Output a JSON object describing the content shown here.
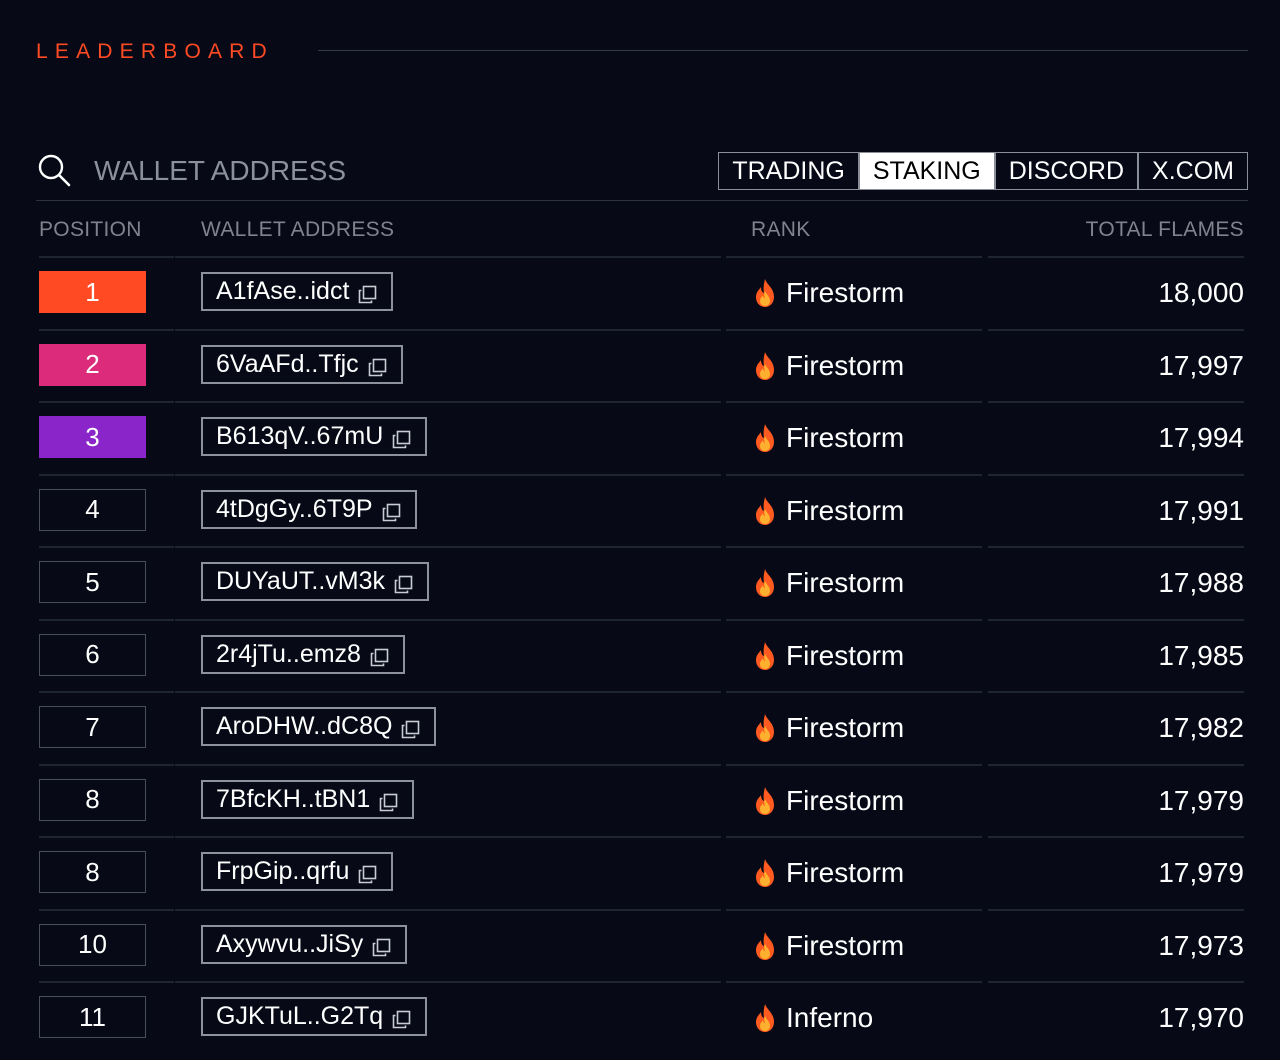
{
  "header": {
    "title": "LEADERBOARD"
  },
  "search": {
    "placeholder": "WALLET ADDRESS",
    "value": ""
  },
  "tabs": [
    {
      "label": "TRADING",
      "active": false
    },
    {
      "label": "STAKING",
      "active": true
    },
    {
      "label": "DISCORD",
      "active": false
    },
    {
      "label": "X.COM",
      "active": false
    }
  ],
  "columns": {
    "position": "POSITION",
    "wallet": "WALLET ADDRESS",
    "rank": "RANK",
    "flames": "TOTAL FLAMES"
  },
  "colors": {
    "accent": "#ff4a23",
    "pos1": "#ff4a23",
    "pos2": "#db2b7a",
    "pos3": "#8a26c9"
  },
  "rows": [
    {
      "position": "1",
      "wallet": "A1fAse..idct",
      "rank": "Firestorm",
      "flames": "18,000"
    },
    {
      "position": "2",
      "wallet": "6VaAFd..Tfjc",
      "rank": "Firestorm",
      "flames": "17,997"
    },
    {
      "position": "3",
      "wallet": "B613qV..67mU",
      "rank": "Firestorm",
      "flames": "17,994"
    },
    {
      "position": "4",
      "wallet": "4tDgGy..6T9P",
      "rank": "Firestorm",
      "flames": "17,991"
    },
    {
      "position": "5",
      "wallet": "DUYaUT..vM3k",
      "rank": "Firestorm",
      "flames": "17,988"
    },
    {
      "position": "6",
      "wallet": "2r4jTu..emz8",
      "rank": "Firestorm",
      "flames": "17,985"
    },
    {
      "position": "7",
      "wallet": "AroDHW..dC8Q",
      "rank": "Firestorm",
      "flames": "17,982"
    },
    {
      "position": "8",
      "wallet": "7BfcKH..tBN1",
      "rank": "Firestorm",
      "flames": "17,979"
    },
    {
      "position": "8",
      "wallet": "FrpGip..qrfu",
      "rank": "Firestorm",
      "flames": "17,979"
    },
    {
      "position": "10",
      "wallet": "Axywvu..JiSy",
      "rank": "Firestorm",
      "flames": "17,973"
    },
    {
      "position": "11",
      "wallet": "GJKTuL..G2Tq",
      "rank": "Inferno",
      "flames": "17,970"
    }
  ]
}
